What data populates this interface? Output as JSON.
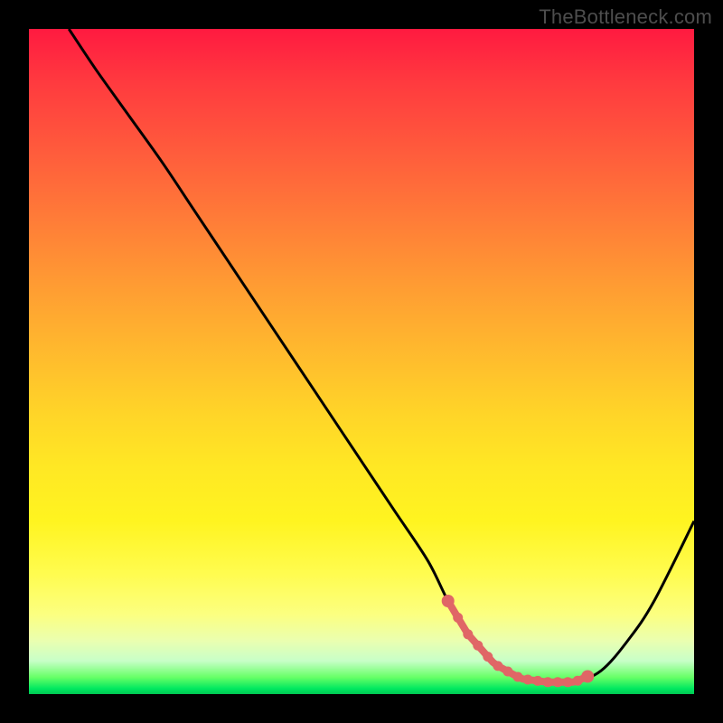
{
  "watermark": "TheBottleneck.com",
  "colors": {
    "frame": "#000000",
    "curve": "#000000",
    "highlight": "#e06666",
    "gradient_top": "#ff1a40",
    "gradient_bottom": "#00c853"
  },
  "chart_data": {
    "type": "line",
    "title": "",
    "xlabel": "",
    "ylabel": "",
    "xlim": [
      0,
      100
    ],
    "ylim": [
      0,
      100
    ],
    "series": [
      {
        "name": "bottleneck-curve",
        "x": [
          6,
          10,
          15,
          20,
          25,
          30,
          35,
          40,
          45,
          50,
          55,
          60,
          63,
          66,
          70,
          74,
          78,
          82,
          86,
          90,
          94,
          100
        ],
        "values": [
          100,
          94,
          87,
          80,
          72.5,
          65,
          57.5,
          50,
          42.5,
          35,
          27.5,
          20,
          14,
          9,
          4.5,
          2.3,
          1.8,
          1.8,
          3.5,
          8,
          14,
          26
        ]
      }
    ],
    "annotations": [
      {
        "name": "optimal-zone",
        "x_range": [
          63,
          84
        ],
        "style": "pink-dotted-band"
      }
    ]
  }
}
